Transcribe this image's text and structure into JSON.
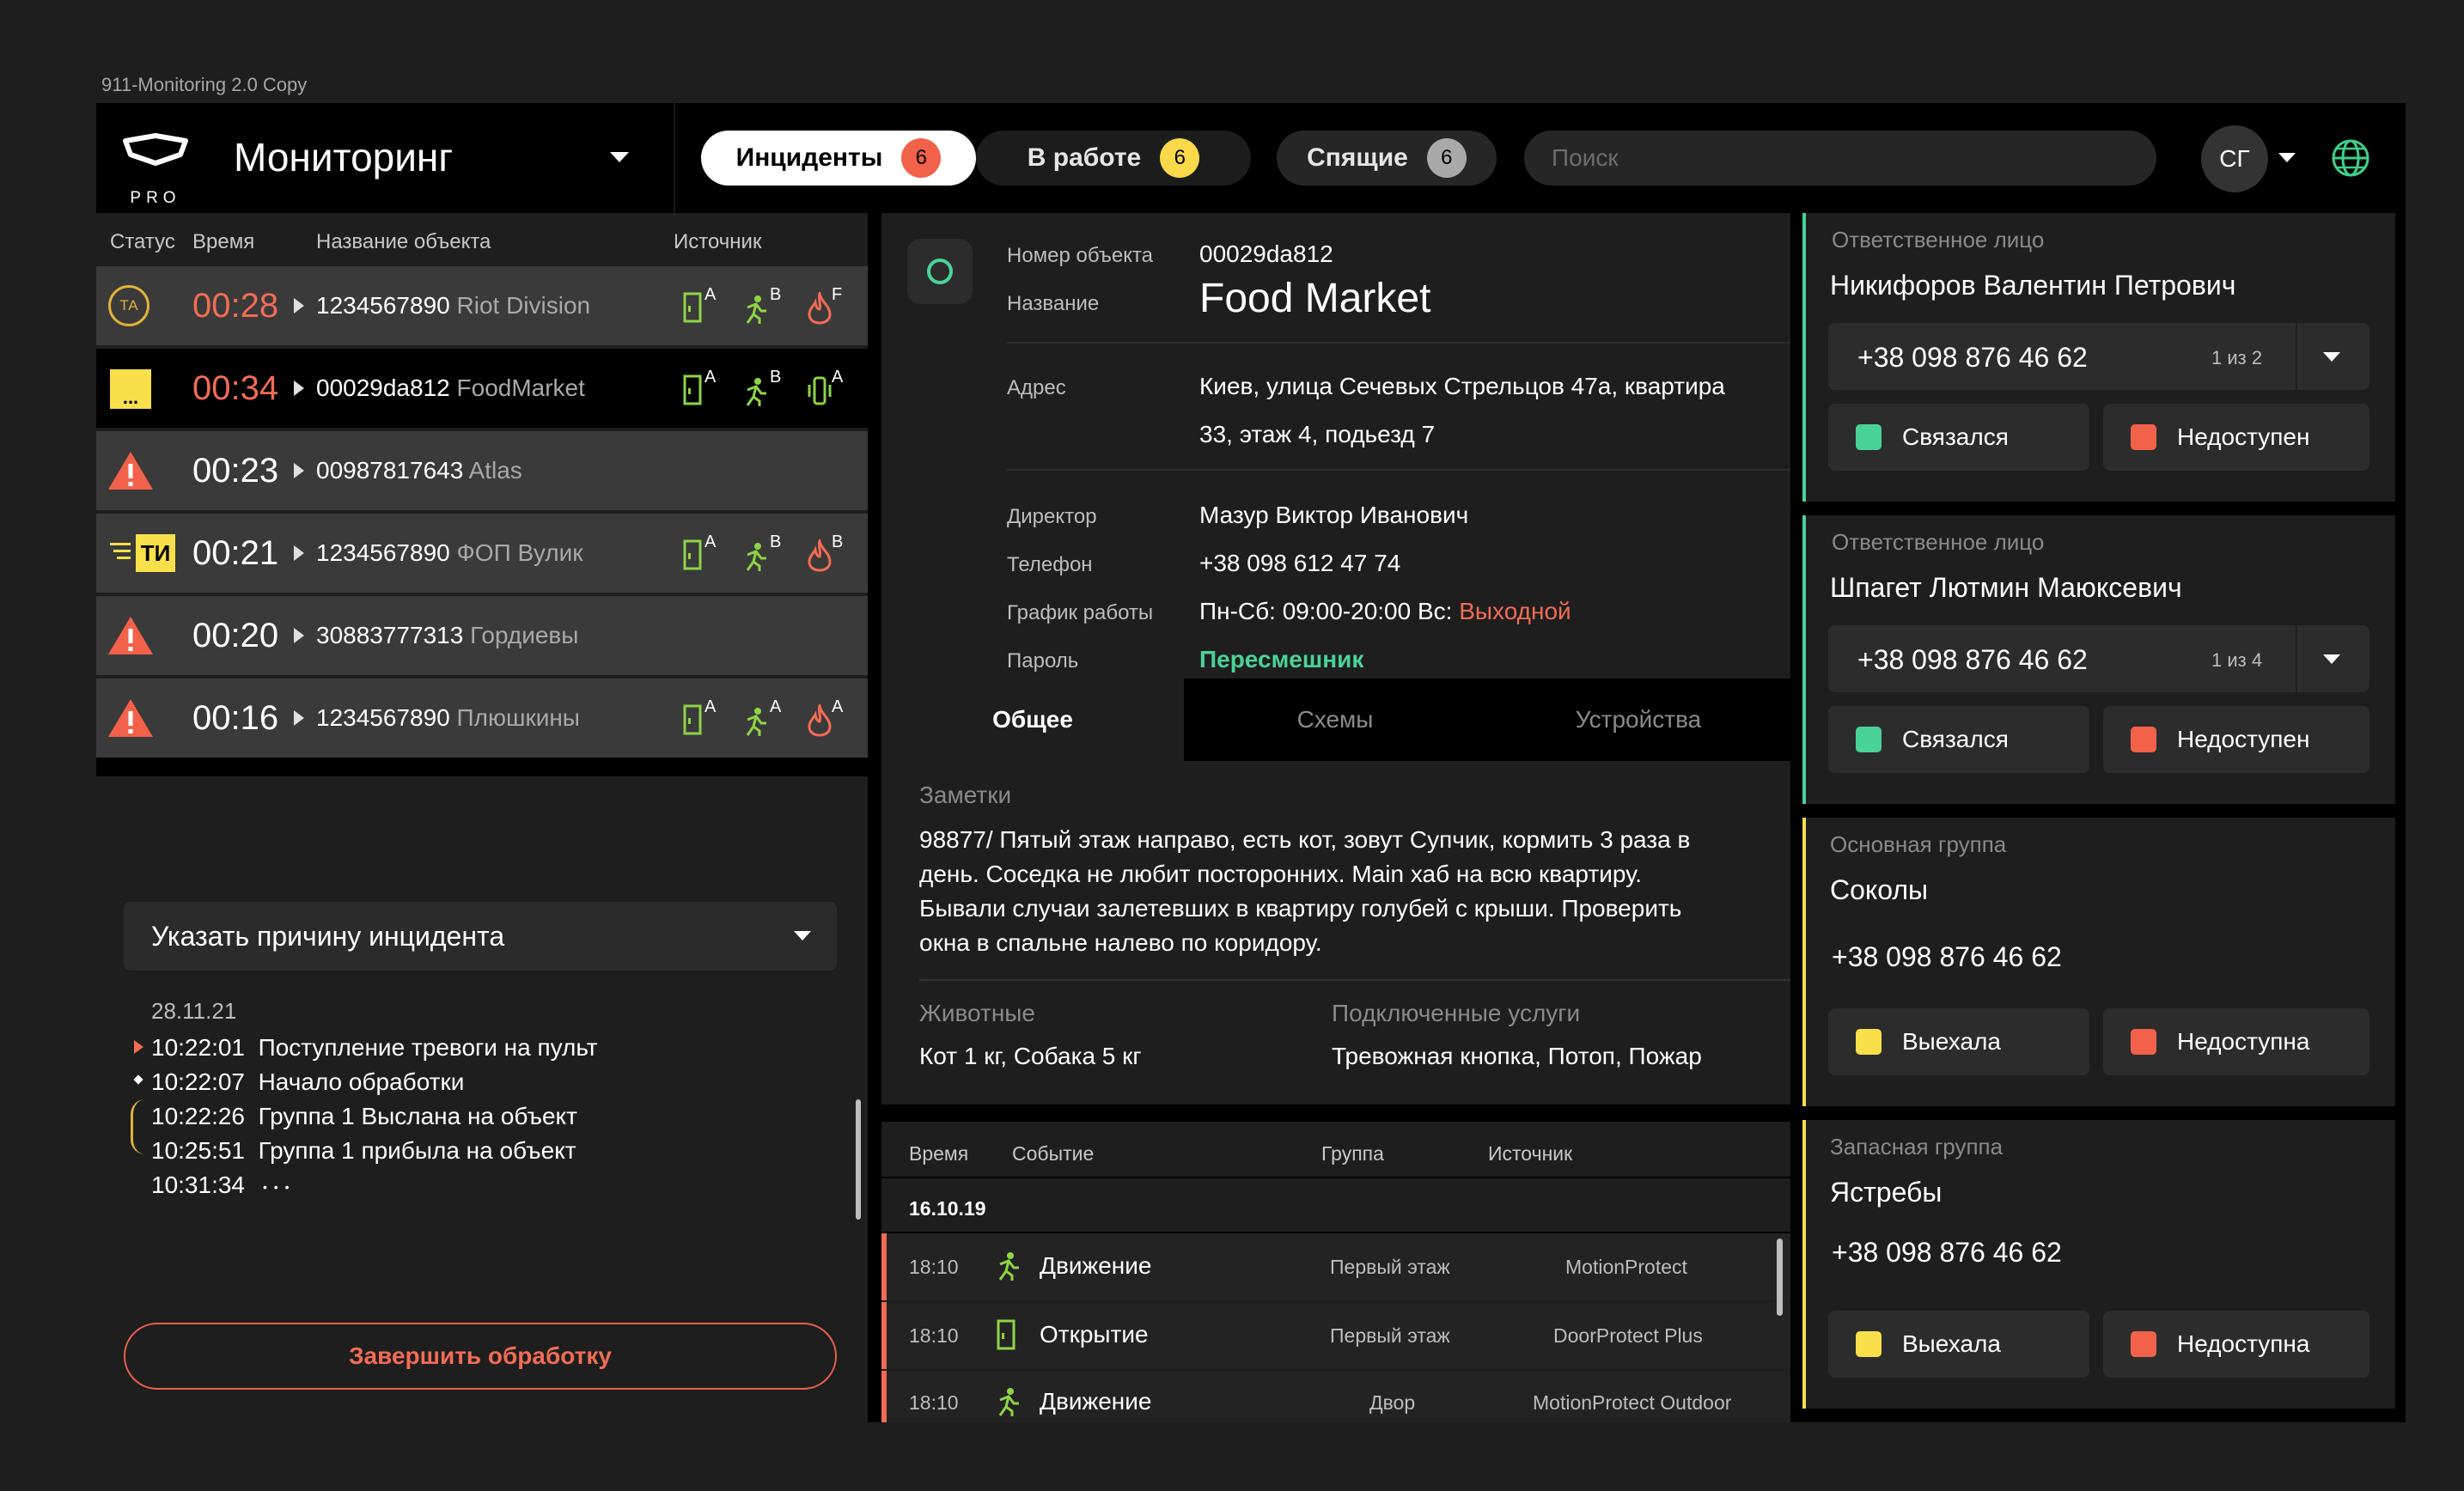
{
  "caption": "911-Monitoring 2.0 Copy",
  "header": {
    "logo_sub": "PRO",
    "title": "Мониторинг",
    "tabs": [
      {
        "label": "Инциденты",
        "count": "6"
      },
      {
        "label": "В работе",
        "count": "6"
      },
      {
        "label": "Спящие",
        "count": "6"
      }
    ],
    "search_placeholder": "Поиск",
    "user_initials": "СГ"
  },
  "list": {
    "headers": {
      "status": "Статус",
      "time": "Время",
      "name": "Название объекта",
      "source": "Источник"
    },
    "rows": [
      {
        "status": "ТА",
        "time": "00:28",
        "id": "1234567890",
        "name": "Riot Division",
        "s1": "A",
        "s2": "B",
        "s3": "F"
      },
      {
        "status": "...",
        "time": "00:34",
        "id": "00029da812",
        "name": "FoodMarket",
        "s1": "A",
        "s2": "B",
        "s3": "A"
      },
      {
        "time": "00:23",
        "id": "00987817643",
        "name": "Atlas"
      },
      {
        "status": "ТИ",
        "time": "00:21",
        "id": "1234567890",
        "name": "ФОП Вулик",
        "s1": "A",
        "s2": "B",
        "s3": "B"
      },
      {
        "time": "00:20",
        "id": "30883777313",
        "name": "Гордиевы"
      },
      {
        "time": "00:16",
        "id": "1234567890",
        "name": "Плюшкины",
        "s1": "A",
        "s2": "A",
        "s3": "A"
      }
    ]
  },
  "incident": {
    "reason_placeholder": "Указать причину инцидента",
    "date": "28.11.21",
    "log": [
      {
        "time": "10:22:01",
        "text": "Поступление тревоги на пульт"
      },
      {
        "time": "10:22:07",
        "text": "Начало обработки"
      },
      {
        "time": "10:22:26",
        "text": "Группа 1 Выслана на объект"
      },
      {
        "time": "10:25:51",
        "text": "Группа 1 прибыла на объект"
      },
      {
        "time": "10:31:34",
        "text": ""
      }
    ],
    "finish_label": "Завершить обработку"
  },
  "object": {
    "number_label": "Номер объекта",
    "number": "00029da812",
    "name_label": "Название",
    "name": "Food Market",
    "address_label": "Адрес",
    "address_1": "Киев, улица Сечевых Стрельцов 47а, квартира",
    "address_2": "33, этаж 4, подьезд 7",
    "director_label": "Директор",
    "director": "Мазур Виктор Иванович",
    "phone_label": "Телефон",
    "phone": "+38 098 612 47 74",
    "schedule_label": "График работы",
    "schedule": "Пн-Сб: 09:00-20:00 Вс:",
    "schedule_off": "Выходной",
    "password_label": "Пароль",
    "password": "Пересмешник"
  },
  "tabs": [
    "Общее",
    "Схемы",
    "Устройства"
  ],
  "notes": {
    "label": "Заметки",
    "lines": [
      "98877/ Пятый этаж направо, есть кот, зовут Супчик, кормить 3 раза в",
      "день. Соседка не любит посторонних. Main хаб на всю квартиру.",
      "Бывали случаи залетевших в квартиру голубей с крыши. Проверить",
      "окна в спальне налево по коридору."
    ],
    "animals_label": "Животные",
    "animals": "Кот 1 кг, Собака 5 кг",
    "services_label": "Подключенные услуги",
    "services": "Тревожная кнопка, Потоп, Пожар"
  },
  "events": {
    "headers": {
      "time": "Время",
      "event": "Событие",
      "group": "Группа",
      "source": "Источник"
    },
    "date": "16.10.19",
    "rows": [
      {
        "time": "18:10",
        "event": "Движение",
        "group": "Первый этаж",
        "source": "MotionProtect"
      },
      {
        "time": "18:10",
        "event": "Открытие",
        "group": "Первый этаж",
        "source": "DoorProtect Plus"
      },
      {
        "time": "18:10",
        "event": "Движение",
        "group": "Двор",
        "source": "MotionProtect Outdoor"
      }
    ]
  },
  "contacts": [
    {
      "label": "Ответственное лицо",
      "name": "Никифоров Валентин Петрович",
      "phone": "+38 098 876 46 62",
      "page": "1 из 2",
      "btn_ok": "Связался",
      "btn_no": "Недоступен"
    },
    {
      "label": "Ответственное лицо",
      "name": "Шпагет Лютмин Маюксевич",
      "phone": "+38 098 876 46 62",
      "page": "1 из 4",
      "btn_ok": "Связался",
      "btn_no": "Недоступен"
    },
    {
      "label": "Основная группа",
      "name": "Соколы",
      "phone": "+38 098 876 46 62",
      "btn_ok": "Выехала",
      "btn_no": "Недоступна"
    },
    {
      "label": "Запасная группа",
      "name": "Ястребы",
      "phone": "+38 098 876 46 62",
      "btn_ok": "Выехала",
      "btn_no": "Недоступна"
    }
  ],
  "colors": {
    "accent_red": "#f26c55",
    "accent_yellow": "#f9e04b",
    "accent_green": "#4ad398",
    "badge_red": "#f26149",
    "badge_yellow": "#f9d84a",
    "badge_gray": "#a9a9a9"
  }
}
